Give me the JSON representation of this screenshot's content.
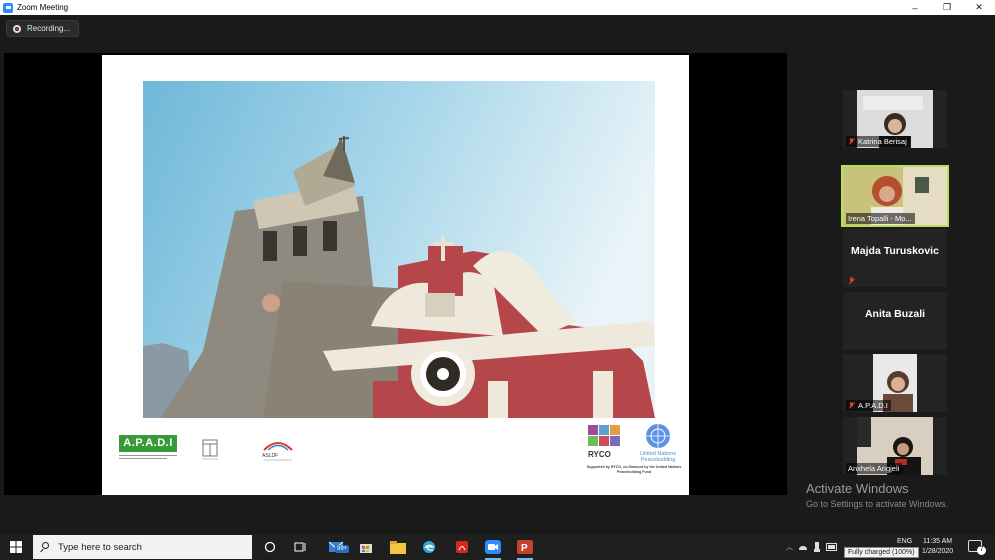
{
  "window": {
    "title": "Zoom Meeting",
    "controls": {
      "minimize": "–",
      "maximize": "❐",
      "close": "✕"
    }
  },
  "recording": {
    "label": "Recording..."
  },
  "slide": {
    "logos": {
      "apadi": "A.P.A.D.I",
      "ryco": "RYCO",
      "un": "United Nations Peacebuilding",
      "support": "Supported by RYCO, co-financed by the United Nations Peacebuilding Fund",
      "kmsh_label": "ASLDF"
    }
  },
  "participants": [
    {
      "name": "Katrina Berisaj",
      "muted": true,
      "video": true
    },
    {
      "name": "Irena Topalli - Mo...",
      "muted": false,
      "video": true,
      "active": true
    },
    {
      "name": "Majda Turuskovic",
      "muted": true,
      "video": false
    },
    {
      "name": "Anita Buzali",
      "muted": false,
      "video": false
    },
    {
      "name": "A.P.A.D.I",
      "muted": true,
      "video": true
    },
    {
      "name": "Anxhela Angjeli",
      "muted": false,
      "video": true
    }
  ],
  "watermark": {
    "title": "Activate Windows",
    "subtitle": "Go to Settings to activate Windows."
  },
  "taskbar": {
    "search_placeholder": "Type here to search",
    "mail_badge": "99+",
    "language": "ENG",
    "time": "11:35 AM",
    "date": "1/28/2020",
    "battery_tooltip": "Fully charged (100%)",
    "notification_count": "7"
  },
  "colors": {
    "active_speaker_border": "#b5e05a",
    "zoom_blue": "#2d8cff",
    "muted_red": "#e0392f"
  }
}
